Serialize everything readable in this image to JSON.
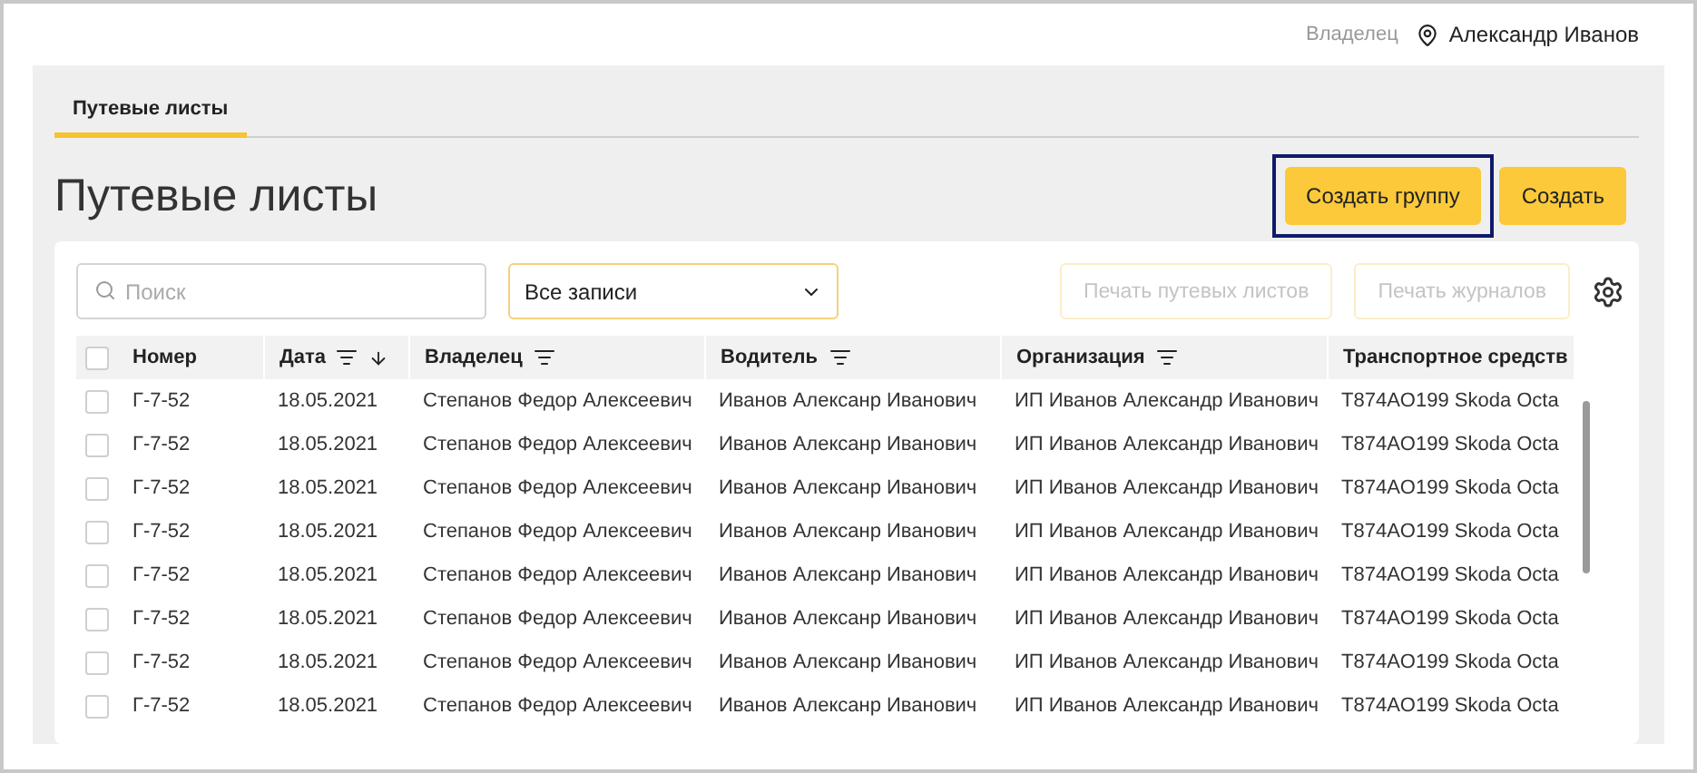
{
  "header": {
    "role": "Владелец",
    "user": "Александр Иванов"
  },
  "tabs": [
    {
      "label": "Путевые листы",
      "selected": true
    }
  ],
  "title": "Путевые листы",
  "actions": [
    {
      "label": "Создать группу",
      "focused": true
    },
    {
      "label": "Создать",
      "focused": false
    }
  ],
  "toolbar": {
    "search": {
      "placeholder": "Поиск"
    },
    "filter": {
      "value": "Все записи"
    },
    "print_buttons": [
      {
        "label": "Печать путевых листов",
        "disabled": true
      },
      {
        "label": "Печать журналов",
        "disabled": true
      }
    ]
  },
  "table": {
    "columns": [
      {
        "label": "Номер",
        "filter": false,
        "sorted": false
      },
      {
        "label": "Дата",
        "filter": true,
        "sorted": true
      },
      {
        "label": "Владелец",
        "filter": true,
        "sorted": false
      },
      {
        "label": "Водитель",
        "filter": true,
        "sorted": false
      },
      {
        "label": "Организация",
        "filter": true,
        "sorted": false
      },
      {
        "label": "Транспортное средств"
      }
    ],
    "all_checked": false,
    "rows": [
      {
        "checked": false,
        "cells": [
          "Г-7-52",
          "18.05.2021",
          "Степанов Федор Алексеевич",
          "Иванов Алексанр Иванович",
          "ИП Иванов Александр Иванович",
          "T874AO199 Skoda Octa"
        ]
      },
      {
        "checked": false,
        "cells": [
          "Г-7-52",
          "18.05.2021",
          "Степанов Федор Алексеевич",
          "Иванов Алексанр Иванович",
          "ИП Иванов Александр Иванович",
          "T874AO199 Skoda Octa"
        ]
      },
      {
        "checked": false,
        "cells": [
          "Г-7-52",
          "18.05.2021",
          "Степанов Федор Алексеевич",
          "Иванов Алексанр Иванович",
          "ИП Иванов Александр Иванович",
          "T874AO199 Skoda Octa"
        ]
      },
      {
        "checked": false,
        "cells": [
          "Г-7-52",
          "18.05.2021",
          "Степанов Федор Алексеевич",
          "Иванов Алексанр Иванович",
          "ИП Иванов Александр Иванович",
          "T874AO199 Skoda Octa"
        ]
      },
      {
        "checked": false,
        "cells": [
          "Г-7-52",
          "18.05.2021",
          "Степанов Федор Алексеевич",
          "Иванов Алексанр Иванович",
          "ИП Иванов Александр Иванович",
          "T874AO199 Skoda Octa"
        ]
      },
      {
        "checked": false,
        "cells": [
          "Г-7-52",
          "18.05.2021",
          "Степанов Федор Алексеевич",
          "Иванов Алексанр Иванович",
          "ИП Иванов Александр Иванович",
          "T874AO199 Skoda Octa"
        ]
      },
      {
        "checked": false,
        "cells": [
          "Г-7-52",
          "18.05.2021",
          "Степанов Федор Алексеевич",
          "Иванов Алексанр Иванович",
          "ИП Иванов Александр Иванович",
          "T874AO199 Skoda Octa"
        ]
      },
      {
        "checked": false,
        "cells": [
          "Г-7-52",
          "18.05.2021",
          "Степанов Федор Алексеевич",
          "Иванов Алексанр Иванович",
          "ИП Иванов Александр Иванович",
          "T874AO199 Skoda Octa"
        ]
      }
    ]
  }
}
